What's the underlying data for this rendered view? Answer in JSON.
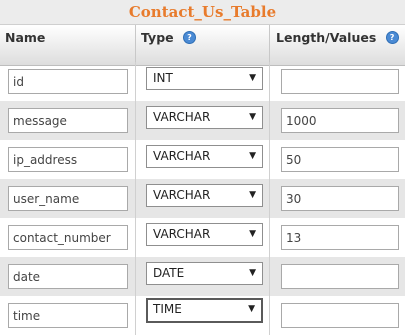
{
  "table_title": "Contact_Us_Table",
  "headers": {
    "name": "Name",
    "type": "Type",
    "length": "Length/Values",
    "help_glyph": "?"
  },
  "select_arrow": "▼",
  "rows": [
    {
      "name": "id",
      "type": "INT",
      "length": ""
    },
    {
      "name": "message",
      "type": "VARCHAR",
      "length": "1000"
    },
    {
      "name": "ip_address",
      "type": "VARCHAR",
      "length": "50"
    },
    {
      "name": "user_name",
      "type": "VARCHAR",
      "length": "30"
    },
    {
      "name": "contact_number",
      "type": "VARCHAR",
      "length": "13"
    },
    {
      "name": "date",
      "type": "DATE",
      "length": ""
    },
    {
      "name": "time",
      "type": "TIME",
      "length": ""
    }
  ],
  "colors": {
    "title_text": "#e87b2c",
    "alt_row": "#e6e6e6",
    "help_icon": "#4a8ad4"
  }
}
